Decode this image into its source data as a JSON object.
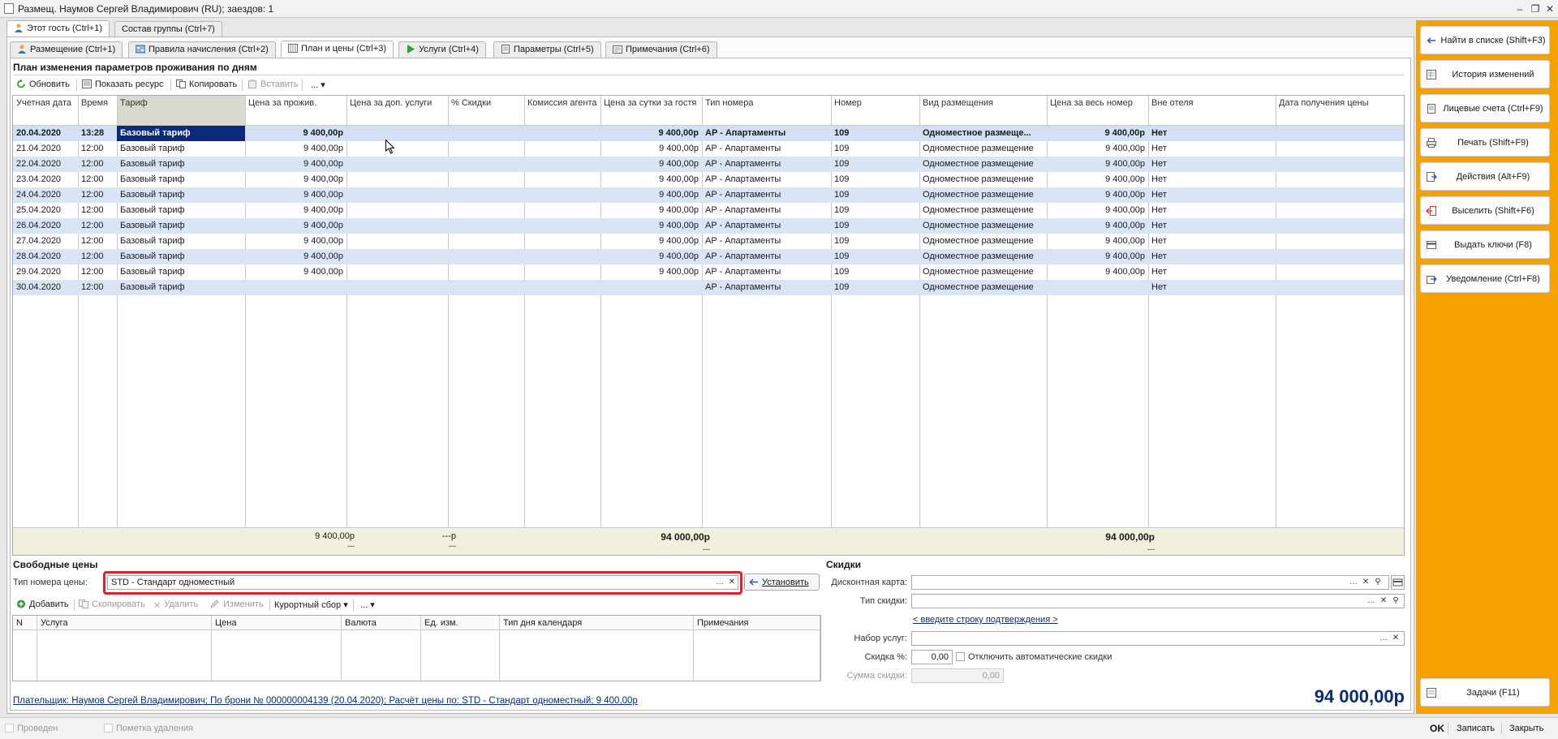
{
  "window": {
    "title": "Размещ. Наумов Сергей Владимирович (RU); заездов: 1"
  },
  "top_tabs": [
    {
      "label": "Этот гость (Ctrl+1)",
      "active": true
    },
    {
      "label": "Состав группы (Ctrl+7)",
      "active": false
    }
  ],
  "sub_tabs": [
    {
      "label": "Размещение (Ctrl+1)",
      "icon": "person-icon"
    },
    {
      "label": "Правила начисления (Ctrl+2)",
      "icon": "rules-icon"
    },
    {
      "label": "План и цены (Ctrl+3)",
      "icon": "plan-icon",
      "active": true
    },
    {
      "label": "Услуги (Ctrl+4)",
      "icon": "play-icon"
    },
    {
      "label": "Параметры (Ctrl+5)",
      "icon": "document-icon"
    },
    {
      "label": "Примечания (Ctrl+6)",
      "icon": "notes-icon"
    }
  ],
  "plan": {
    "title": "План изменения параметров проживания по дням",
    "toolbar": {
      "refresh": "Обновить",
      "show_resource": "Показать ресурс",
      "copy": "Копировать",
      "paste": "Вставить",
      "more": "..."
    },
    "columns": [
      "Учетная дата",
      "Время",
      "Тариф",
      "Цена за прожив.",
      "Цена за доп. услуги",
      "% Скидки",
      "Комиссия агента",
      "Цена за сутки за гостя",
      "Тип номера",
      "Номер",
      "Вид размещения",
      "Цена за весь номер",
      "Вне отеля",
      "Дата получения цены"
    ],
    "rows": [
      [
        "20.04.2020",
        "13:28",
        "Базовый тариф",
        "9 400,00р",
        "",
        "",
        "",
        "9 400,00р",
        "AP - Апартаменты",
        "109",
        "Одноместное размеще...",
        "9 400,00р",
        "Нет",
        ""
      ],
      [
        "21.04.2020",
        "12:00",
        "Базовый тариф",
        "9 400,00р",
        "",
        "",
        "",
        "9 400,00р",
        "AP - Апартаменты",
        "109",
        "Одноместное размещение",
        "9 400,00р",
        "Нет",
        ""
      ],
      [
        "22.04.2020",
        "12:00",
        "Базовый тариф",
        "9 400,00р",
        "",
        "",
        "",
        "9 400,00р",
        "AP - Апартаменты",
        "109",
        "Одноместное размещение",
        "9 400,00р",
        "Нет",
        ""
      ],
      [
        "23.04.2020",
        "12:00",
        "Базовый тариф",
        "9 400,00р",
        "",
        "",
        "",
        "9 400,00р",
        "AP - Апартаменты",
        "109",
        "Одноместное размещение",
        "9 400,00р",
        "Нет",
        ""
      ],
      [
        "24.04.2020",
        "12:00",
        "Базовый тариф",
        "9 400,00р",
        "",
        "",
        "",
        "9 400,00р",
        "AP - Апартаменты",
        "109",
        "Одноместное размещение",
        "9 400,00р",
        "Нет",
        ""
      ],
      [
        "25.04.2020",
        "12:00",
        "Базовый тариф",
        "9 400,00р",
        "",
        "",
        "",
        "9 400,00р",
        "AP - Апартаменты",
        "109",
        "Одноместное размещение",
        "9 400,00р",
        "Нет",
        ""
      ],
      [
        "26.04.2020",
        "12:00",
        "Базовый тариф",
        "9 400,00р",
        "",
        "",
        "",
        "9 400,00р",
        "AP - Апартаменты",
        "109",
        "Одноместное размещение",
        "9 400,00р",
        "Нет",
        ""
      ],
      [
        "27.04.2020",
        "12:00",
        "Базовый тариф",
        "9 400,00р",
        "",
        "",
        "",
        "9 400,00р",
        "AP - Апартаменты",
        "109",
        "Одноместное размещение",
        "9 400,00р",
        "Нет",
        ""
      ],
      [
        "28.04.2020",
        "12:00",
        "Базовый тариф",
        "9 400,00р",
        "",
        "",
        "",
        "9 400,00р",
        "AP - Апартаменты",
        "109",
        "Одноместное размещение",
        "9 400,00р",
        "Нет",
        ""
      ],
      [
        "29.04.2020",
        "12:00",
        "Базовый тариф",
        "9 400,00р",
        "",
        "",
        "",
        "9 400,00р",
        "AP - Апартаменты",
        "109",
        "Одноместное размещение",
        "9 400,00р",
        "Нет",
        ""
      ],
      [
        "30.04.2020",
        "12:00",
        "Базовый тариф",
        "",
        "",
        "",
        "",
        "",
        "AP - Апартаменты",
        "109",
        "Одноместное размещение",
        "",
        "Нет",
        ""
      ]
    ],
    "footer": {
      "total_stay": "9 400,00р",
      "total_stay_sub": "---",
      "total_extra": "---р",
      "total_extra_sub": "---",
      "total_per_guest": "94 000,00р",
      "total_per_guest_sub": "---",
      "total_room": "94 000,00р",
      "total_room_sub": "---"
    }
  },
  "free_prices": {
    "title": "Свободные цены",
    "room_type_label": "Тип номера цены:",
    "room_type_value": "STD - Стандарт одноместный",
    "set_button": "Установить",
    "toolbar": {
      "add": "Добавить",
      "copy": "Скопировать",
      "delete": "Удалить",
      "edit": "Изменить",
      "resort_fee": "Курортный сбор",
      "more": "..."
    },
    "columns": [
      "N",
      "Услуга",
      "Цена",
      "Валюта",
      "Ед. изм.",
      "Тип дня календаря",
      "Примечания"
    ]
  },
  "discounts": {
    "title": "Скидки",
    "card_label": "Дисконтная карта:",
    "card_value": "",
    "type_label": "Тип скидки:",
    "type_value": "",
    "confirm_link": "< введите строку подтверждения >",
    "services_label": "Набор услуг:",
    "services_value": "",
    "percent_label": "Скидка %:",
    "percent_value": "0,00",
    "auto_off_label": "Отключить автоматические скидки",
    "sum_label": "Сумма скидки:",
    "sum_value": "0,00"
  },
  "summary": {
    "payer_link": "Плательщик: Наумов Сергей Владимирович; По брони № 000000004139 (20.04.2020); Расчёт цены по: STD - Стандарт одноместный; 9 400,00р",
    "total": "94 000,00р"
  },
  "actions": [
    {
      "label": "Найти в списке (Shift+F3)",
      "icon": "find-icon"
    },
    {
      "label": "История изменений",
      "icon": "history-icon"
    },
    {
      "label": "Лицевые счета (Ctrl+F9)",
      "icon": "accounts-icon"
    },
    {
      "label": "Печать (Shift+F9)",
      "icon": "printer-icon"
    },
    {
      "label": "Действия (Alt+F9)",
      "icon": "actions-icon"
    },
    {
      "label": "Выселить (Shift+F6)",
      "icon": "checkout-icon"
    },
    {
      "label": "Выдать ключи (F8)",
      "icon": "keys-icon"
    },
    {
      "label": "Уведомление (Ctrl+F8)",
      "icon": "notification-icon"
    }
  ],
  "tasks_button": "Задачи (F11)",
  "status": {
    "posted": "Проведен",
    "deletion_mark": "Пометка удаления"
  },
  "buttons": {
    "ok": "OK",
    "save": "Записать",
    "close": "Закрыть"
  },
  "colors": {
    "accent": "#F5A200",
    "selection": "#0B2A7C",
    "row_alt": "#D9E5F5",
    "highlight_border": "#E0202A"
  }
}
